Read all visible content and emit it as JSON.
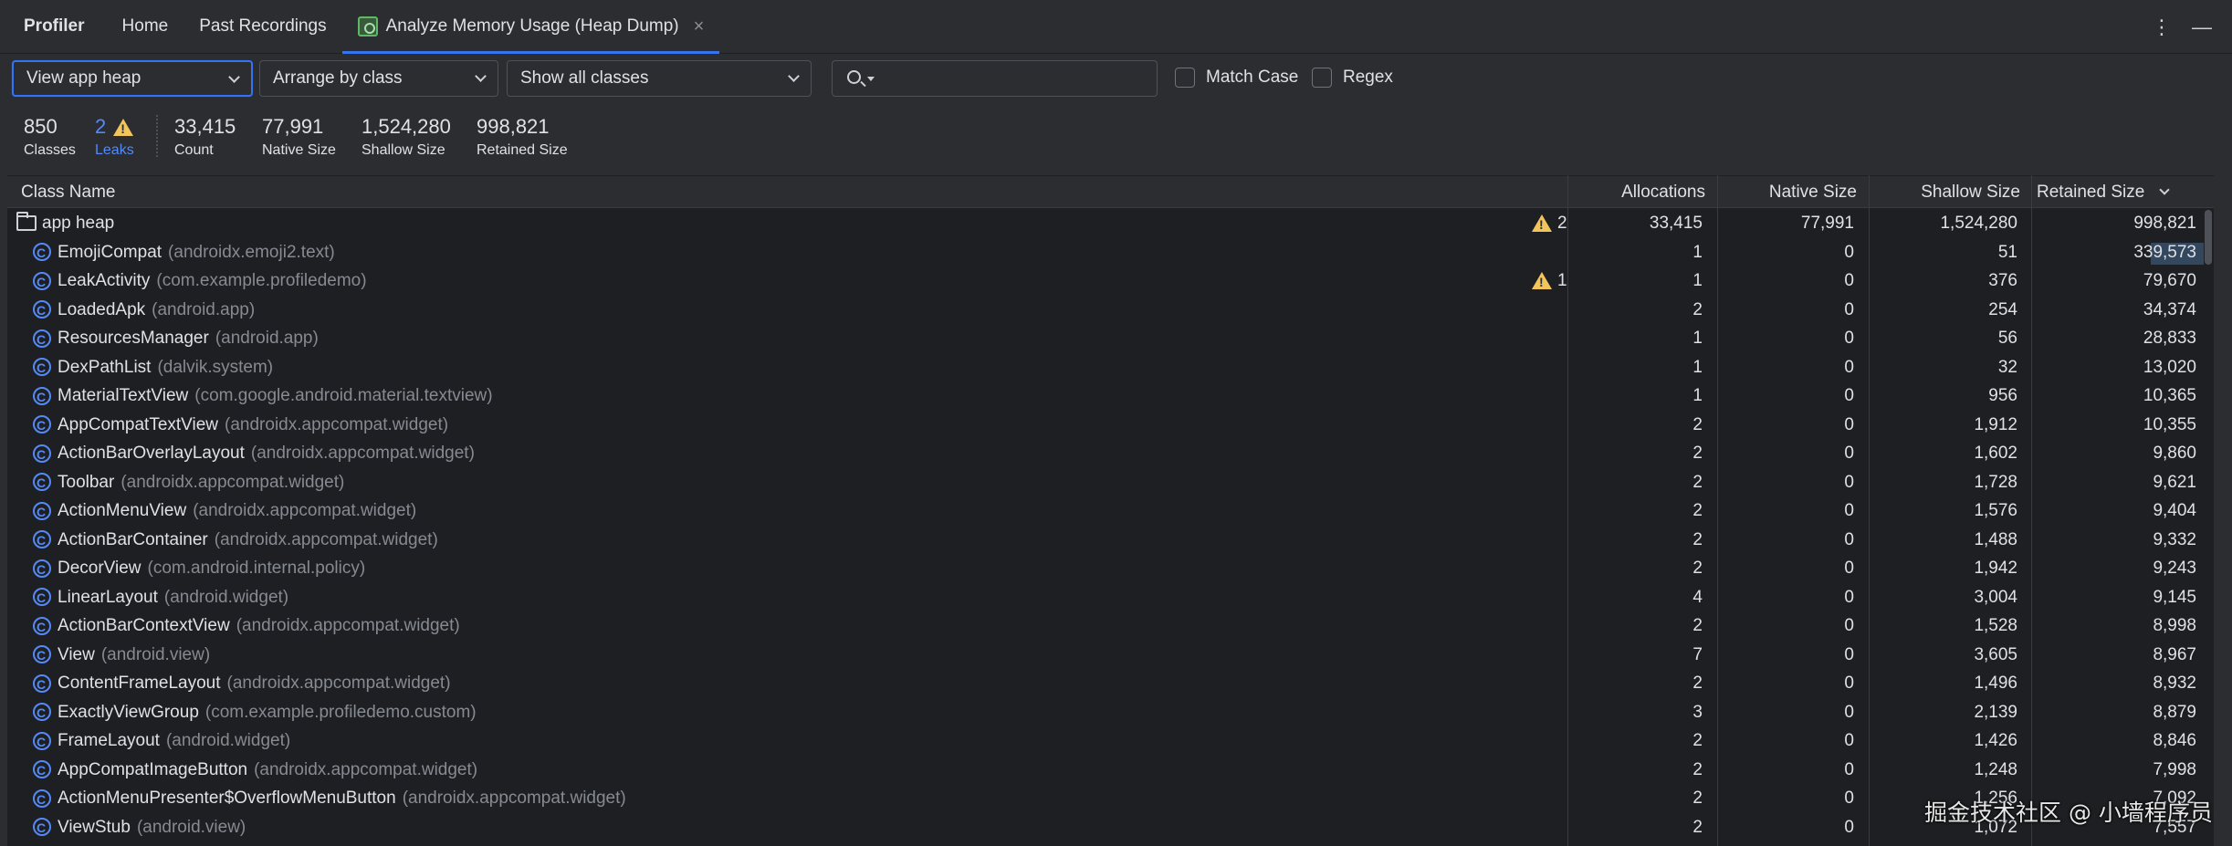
{
  "tabs": {
    "profiler": "Profiler",
    "home": "Home",
    "past": "Past Recordings",
    "active": "Analyze Memory Usage (Heap Dump)",
    "close": "×"
  },
  "top_right": {
    "more": "⋮",
    "minimize": "—"
  },
  "toolbar": {
    "heap_select": "View app heap",
    "arrange_select": "Arrange by class",
    "filter_select": "Show all classes",
    "search_value": "",
    "match_case": "Match Case",
    "regex": "Regex"
  },
  "summary": [
    {
      "value": "850",
      "label": "Classes"
    },
    {
      "value": "2",
      "label": "Leaks"
    },
    {
      "value": "33,415",
      "label": "Count"
    },
    {
      "value": "77,991",
      "label": "Native Size"
    },
    {
      "value": "1,524,280",
      "label": "Shallow Size"
    },
    {
      "value": "998,821",
      "label": "Retained Size"
    }
  ],
  "table": {
    "columns": [
      "Class Name",
      "Allocations",
      "Native Size",
      "Shallow Size",
      "Retained Size"
    ],
    "root": {
      "name": "app heap",
      "leaks": "2",
      "allocations": "33,415",
      "native": "77,991",
      "shallow": "1,524,280",
      "retained": "998,821"
    },
    "rows": [
      {
        "name": "EmojiCompat",
        "pkg": "(androidx.emoji2.text)",
        "leaks": "",
        "allocations": "1",
        "native": "0",
        "shallow": "51",
        "retained": "339,573"
      },
      {
        "name": "LeakActivity",
        "pkg": "(com.example.profiledemo)",
        "leaks": "1",
        "allocations": "1",
        "native": "0",
        "shallow": "376",
        "retained": "79,670"
      },
      {
        "name": "LoadedApk",
        "pkg": "(android.app)",
        "leaks": "",
        "allocations": "2",
        "native": "0",
        "shallow": "254",
        "retained": "34,374"
      },
      {
        "name": "ResourcesManager",
        "pkg": "(android.app)",
        "leaks": "",
        "allocations": "1",
        "native": "0",
        "shallow": "56",
        "retained": "28,833"
      },
      {
        "name": "DexPathList",
        "pkg": "(dalvik.system)",
        "leaks": "",
        "allocations": "1",
        "native": "0",
        "shallow": "32",
        "retained": "13,020"
      },
      {
        "name": "MaterialTextView",
        "pkg": "(com.google.android.material.textview)",
        "leaks": "",
        "allocations": "1",
        "native": "0",
        "shallow": "956",
        "retained": "10,365"
      },
      {
        "name": "AppCompatTextView",
        "pkg": "(androidx.appcompat.widget)",
        "leaks": "",
        "allocations": "2",
        "native": "0",
        "shallow": "1,912",
        "retained": "10,355"
      },
      {
        "name": "ActionBarOverlayLayout",
        "pkg": "(androidx.appcompat.widget)",
        "leaks": "",
        "allocations": "2",
        "native": "0",
        "shallow": "1,602",
        "retained": "9,860"
      },
      {
        "name": "Toolbar",
        "pkg": "(androidx.appcompat.widget)",
        "leaks": "",
        "allocations": "2",
        "native": "0",
        "shallow": "1,728",
        "retained": "9,621"
      },
      {
        "name": "ActionMenuView",
        "pkg": "(androidx.appcompat.widget)",
        "leaks": "",
        "allocations": "2",
        "native": "0",
        "shallow": "1,576",
        "retained": "9,404"
      },
      {
        "name": "ActionBarContainer",
        "pkg": "(androidx.appcompat.widget)",
        "leaks": "",
        "allocations": "2",
        "native": "0",
        "shallow": "1,488",
        "retained": "9,332"
      },
      {
        "name": "DecorView",
        "pkg": "(com.android.internal.policy)",
        "leaks": "",
        "allocations": "2",
        "native": "0",
        "shallow": "1,942",
        "retained": "9,243"
      },
      {
        "name": "LinearLayout",
        "pkg": "(android.widget)",
        "leaks": "",
        "allocations": "4",
        "native": "0",
        "shallow": "3,004",
        "retained": "9,145"
      },
      {
        "name": "ActionBarContextView",
        "pkg": "(androidx.appcompat.widget)",
        "leaks": "",
        "allocations": "2",
        "native": "0",
        "shallow": "1,528",
        "retained": "8,998"
      },
      {
        "name": "View",
        "pkg": "(android.view)",
        "leaks": "",
        "allocations": "7",
        "native": "0",
        "shallow": "3,605",
        "retained": "8,967"
      },
      {
        "name": "ContentFrameLayout",
        "pkg": "(androidx.appcompat.widget)",
        "leaks": "",
        "allocations": "2",
        "native": "0",
        "shallow": "1,496",
        "retained": "8,932"
      },
      {
        "name": "ExactlyViewGroup",
        "pkg": "(com.example.profiledemo.custom)",
        "leaks": "",
        "allocations": "3",
        "native": "0",
        "shallow": "2,139",
        "retained": "8,879"
      },
      {
        "name": "FrameLayout",
        "pkg": "(android.widget)",
        "leaks": "",
        "allocations": "2",
        "native": "0",
        "shallow": "1,426",
        "retained": "8,846"
      },
      {
        "name": "AppCompatImageButton",
        "pkg": "(androidx.appcompat.widget)",
        "leaks": "",
        "allocations": "2",
        "native": "0",
        "shallow": "1,248",
        "retained": "7,998"
      },
      {
        "name": "ActionMenuPresenter$OverflowMenuButton",
        "pkg": "(androidx.appcompat.widget)",
        "leaks": "",
        "allocations": "2",
        "native": "0",
        "shallow": "1,256",
        "retained": "7,092"
      },
      {
        "name": "ViewStub",
        "pkg": "(android.view)",
        "leaks": "",
        "allocations": "2",
        "native": "0",
        "shallow": "1,072",
        "retained": "7,557"
      }
    ]
  },
  "watermark": "掘金技术社区 @ 小墙程序员"
}
